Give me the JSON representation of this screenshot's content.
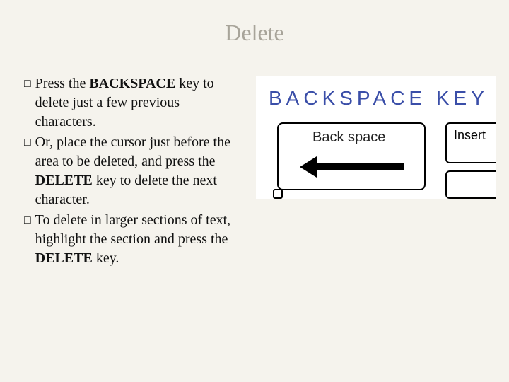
{
  "title": "Delete",
  "bullets": [
    {
      "mark": "□",
      "pre": "Press the ",
      "bold1": "BACKSPACE",
      "post1": " key to delete just a few previous characters."
    },
    {
      "mark": "□",
      "pre": "Or, place the cursor just before the area to be deleted, and press the ",
      "bold1": "DELETE",
      "post1": " key to delete the next character."
    },
    {
      "mark": "□",
      "pre": "To delete in larger sections of text, highlight the section and press the ",
      "bold1": "DELETE",
      "post1": " key."
    }
  ],
  "keyboard": {
    "title": "BACKSPACE KEY",
    "backspace_label": "Back space",
    "insert_label": "Insert"
  }
}
